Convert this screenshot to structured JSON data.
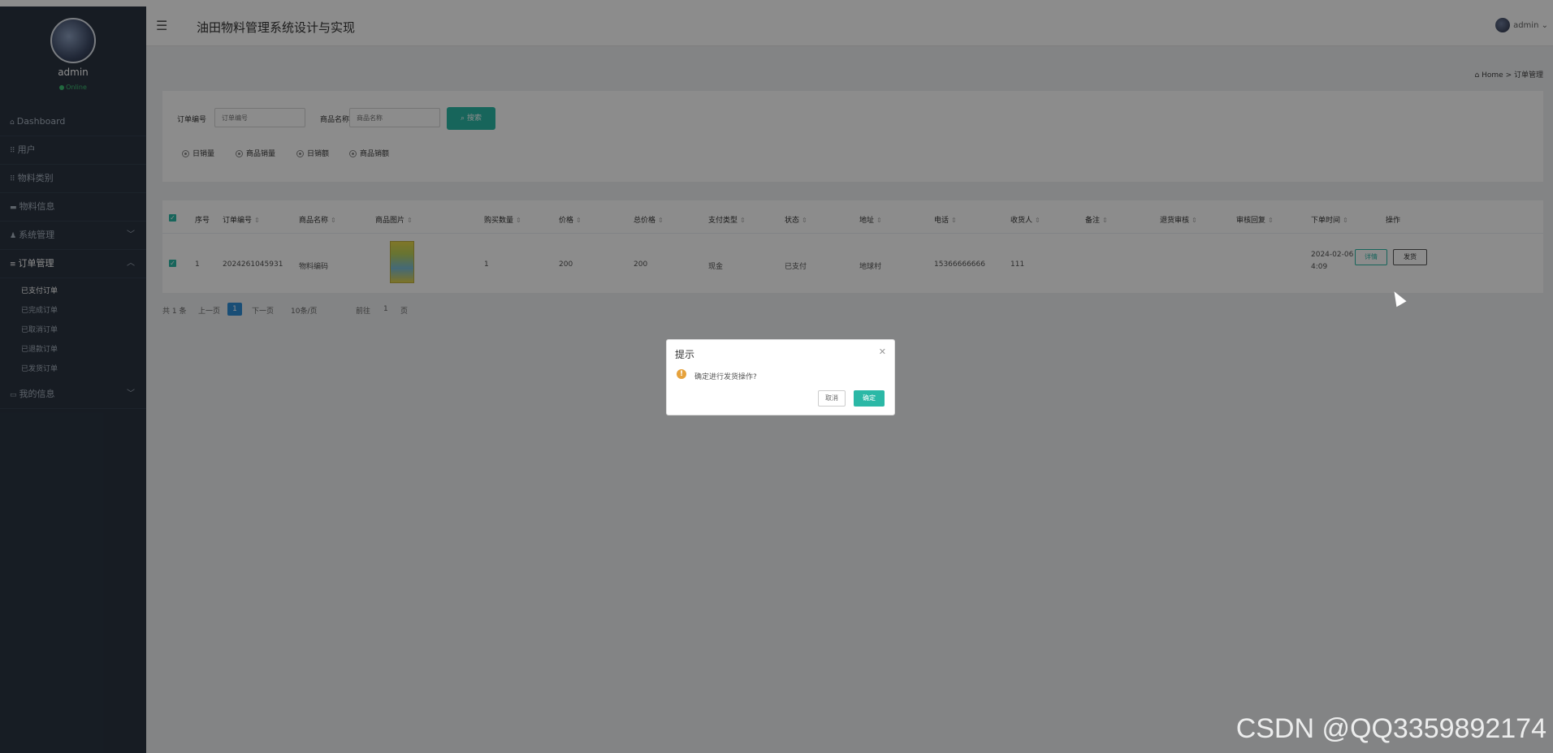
{
  "sidebar": {
    "user_name": "admin",
    "status": "Online",
    "items": [
      {
        "icon": "home-icon",
        "label": "Dashboard"
      },
      {
        "icon": "grid-icon",
        "label": "用户"
      },
      {
        "icon": "grid-icon",
        "label": "物料类别"
      },
      {
        "icon": "doc-icon",
        "label": "物料信息"
      },
      {
        "icon": "user-icon",
        "label": "系统管理"
      },
      {
        "icon": "list-icon",
        "label": "订单管理"
      },
      {
        "icon": "card-icon",
        "label": "我的信息"
      }
    ],
    "submenu": [
      "已支付订单",
      "已完成订单",
      "已取消订单",
      "已退款订单",
      "已发货订单"
    ]
  },
  "header": {
    "title": "油田物料管理系统设计与实现",
    "user": "admin"
  },
  "breadcrumb": {
    "home": "Home",
    "sep": ">",
    "current": "订单管理"
  },
  "search": {
    "order_label": "订单编号",
    "order_placeholder": "订单编号",
    "product_label": "商品名称",
    "product_placeholder": "商品名称",
    "button": "搜索",
    "radios": [
      "日销量",
      "商品销量",
      "日销额",
      "商品销额"
    ]
  },
  "table": {
    "headers": [
      "序号",
      "订单编号",
      "商品名称",
      "商品图片",
      "购买数量",
      "价格",
      "总价格",
      "支付类型",
      "状态",
      "地址",
      "电话",
      "收货人",
      "备注",
      "退货审核",
      "审核回复",
      "下单时间",
      "操作"
    ],
    "rows": [
      {
        "index": "1",
        "order_no": "2024261045931",
        "product_name": "物料编码",
        "quantity": "1",
        "price": "200",
        "total": "200",
        "pay_type": "现金",
        "status": "已支付",
        "address": "地球村",
        "phone": "15366666666",
        "receiver": "111",
        "remark": "",
        "return_review": "",
        "review_reply": "",
        "order_time_line1": "2024-02-06 10:0",
        "order_time_line2": "4:09",
        "detail_btn": "详情",
        "ship_btn": "发货"
      }
    ]
  },
  "pagination": {
    "total": "共 1 条",
    "prev": "上一页",
    "current": "1",
    "next": "下一页",
    "page_size": "10条/页",
    "goto_prefix": "前往",
    "goto_value": "1",
    "goto_suffix": "页"
  },
  "dialog": {
    "title": "提示",
    "message": "确定进行发货操作?",
    "cancel": "取消",
    "confirm": "确定"
  },
  "watermark": "CSDN @QQ3359892174",
  "colors": {
    "accent": "#2bb8a6",
    "sidebar": "#2a3441",
    "warn": "#e6a23c",
    "page_active": "#2f8ed8"
  }
}
